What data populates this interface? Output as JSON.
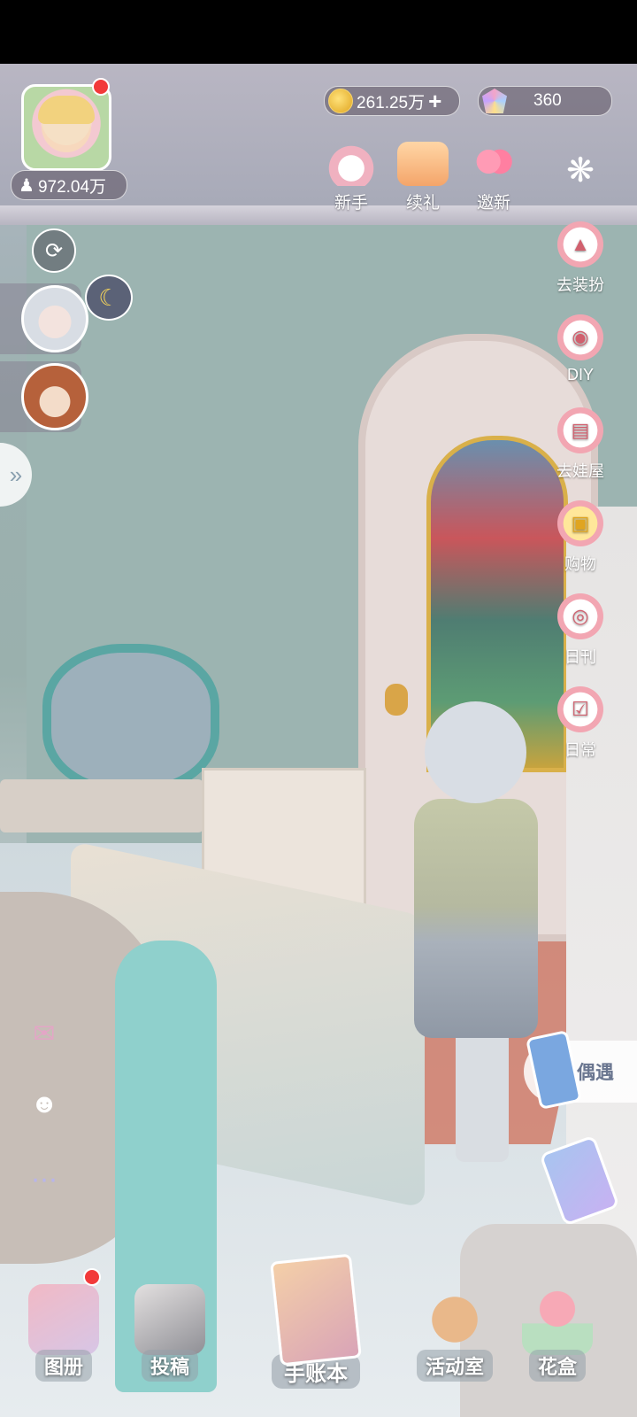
{
  "player": {
    "followers": "972.04万"
  },
  "currency": {
    "coins": "261.25万",
    "gems": "360"
  },
  "top_menu": [
    {
      "label": "新手",
      "icon": "bunny-bath-icon"
    },
    {
      "label": "续礼",
      "icon": "tv-gift-icon"
    },
    {
      "label": "邀新",
      "icon": "hearts-icon"
    }
  ],
  "settings_icon": "flower-settings-icon",
  "side_menu": [
    {
      "label": "去装扮",
      "icon": "shirt-icon"
    },
    {
      "label": "DIY",
      "icon": "palette-icon"
    },
    {
      "label": "去娃屋",
      "icon": "cabinet-icon"
    },
    {
      "label": "购物",
      "icon": "shopping-bag-icon"
    },
    {
      "label": "日刊",
      "icon": "camera-icon"
    },
    {
      "label": "日常",
      "icon": "clipboard-icon"
    }
  ],
  "encounter": {
    "label": "偶遇"
  },
  "bottom_menu": [
    {
      "label": "图册"
    },
    {
      "label": "投稿"
    },
    {
      "label": "手账本"
    },
    {
      "label": "活动室"
    },
    {
      "label": "花盒"
    }
  ],
  "colors": {
    "accent_pink": "#f2a6b2",
    "notify_red": "#f23a3a",
    "coin_gold": "#e0a520"
  }
}
